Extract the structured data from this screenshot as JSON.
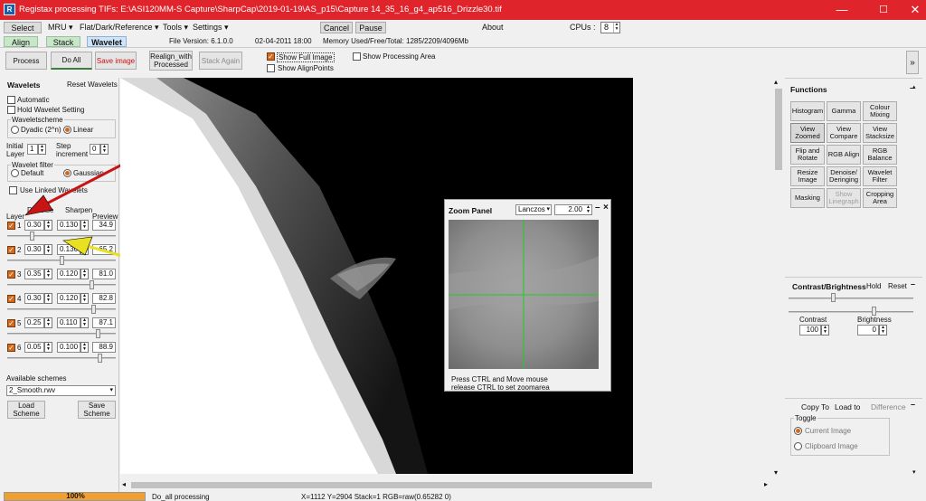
{
  "window": {
    "title": "Registax processing TIFs: E:\\ASI120MM-S Capture\\SharpCap\\2019-01-19\\AS_p15\\Capture 14_35_16_g4_ap516_Drizzle30.tif",
    "app_icon": "registax-icon",
    "minimize": "—",
    "maximize": "☐",
    "close": "✕"
  },
  "menubar": {
    "select": "Select",
    "mru": "MRU",
    "flat": "Flat/Dark/Reference",
    "tools": "Tools",
    "settings": "Settings",
    "cancel": "Cancel",
    "pause": "Pause",
    "about": "About",
    "cpus_label": "CPUs :",
    "cpus_value": "8"
  },
  "tabs": {
    "align": "Align",
    "stack": "Stack",
    "wavelet": "Wavelet",
    "file_version": "File Version: 6.1.0.0",
    "date": "02-04-2011 18:00",
    "memory": "Memory Used/Free/Total: 1285/2209/4096Mb"
  },
  "toolbar": {
    "process": "Process",
    "do_all": "Do All",
    "save_image": "Save image",
    "realign": "Realign_with Processed",
    "stack_again": "Stack Again",
    "show_full_image": "Show Full Image",
    "show_alignpoints": "Show AlignPoints",
    "show_processing_area": "Show Processing Area",
    "expand": "»"
  },
  "wavelets": {
    "title": "Wavelets",
    "reset": "Reset Wavelets",
    "automatic": "Automatic",
    "hold": "Hold Wavelet Setting",
    "scheme_title": "Waveletscheme",
    "dyadic": "Dyadic (2^n)",
    "linear": "Linear",
    "initial_layer_label": "Initial Layer",
    "initial_layer_value": "1",
    "step_label": "Step increment",
    "step_value": "0",
    "filter_title": "Wavelet filter",
    "default": "Default",
    "gaussian": "Gaussian",
    "linked": "Use Linked Wavelets",
    "col_layer": "Layer",
    "col_denoise": "Denoise",
    "col_sharpen": "Sharpen",
    "col_preview": "Preview",
    "layers": [
      {
        "n": "1",
        "denoise": "0.30",
        "sharpen": "0.130",
        "preview": "34.9",
        "slider": 0.22
      },
      {
        "n": "2",
        "denoise": "0.30",
        "sharpen": "0.130",
        "preview": "65.2",
        "slider": 0.5
      },
      {
        "n": "3",
        "denoise": "0.35",
        "sharpen": "0.120",
        "preview": "81.0",
        "slider": 0.79
      },
      {
        "n": "4",
        "denoise": "0.30",
        "sharpen": "0.120",
        "preview": "82.8",
        "slider": 0.81
      },
      {
        "n": "5",
        "denoise": "0.25",
        "sharpen": "0.110",
        "preview": "87.1",
        "slider": 0.85
      },
      {
        "n": "6",
        "denoise": "0.05",
        "sharpen": "0.100",
        "preview": "88.9",
        "slider": 0.87
      }
    ],
    "available_schemes": "Available schemes",
    "scheme_value": "2_Smooth.rwv",
    "load_scheme": "Load Scheme",
    "save_scheme": "Save Scheme"
  },
  "zoom": {
    "title": "Zoom Panel",
    "method": "Lanczos",
    "factor": "2.00",
    "minimize": "–",
    "close": "×",
    "hint1": "Press CTRL and Move mouse",
    "hint2": "release CTRL to set zoomarea"
  },
  "functions": {
    "title": "Functions",
    "buttons": [
      "Histogram",
      "Gamma",
      "Colour Mixing",
      "View Zoomed",
      "View Compare",
      "View Stacksize",
      "Flip and Rotate",
      "RGB Align",
      "RGB Balance",
      "Resize Image",
      "Denoise/ Deringing",
      "Wavelet Filter",
      "Masking",
      "Show Linegraph",
      "Cropping Area"
    ]
  },
  "contrast": {
    "title": "Contrast/Brightness",
    "hold": "Hold",
    "reset": "Reset",
    "contrast_label": "Contrast",
    "contrast_value": "100",
    "brightness_label": "Brightness",
    "brightness_value": "0",
    "contrast_slider": 0.35,
    "brightness_slider": 0.69
  },
  "copyto": {
    "copy_to": "Copy To",
    "load_to": "Load to",
    "difference": "Difference",
    "toggle_title": "Toggle",
    "current_image": "Current Image",
    "clipboard_image": "Clipboard Image"
  },
  "status": {
    "progress": "100%",
    "progress_fraction": 1.0,
    "message": "Do_all processing",
    "coords": "X=1112 Y=2904 Stack=1 RGB=raw(0.65282 0)"
  },
  "colors": {
    "titlebar": "#e0242c",
    "accent": "#d2691e",
    "arrow_red": "#c81414",
    "arrow_yellow": "#e8e020",
    "crosshair": "#22cc22"
  }
}
